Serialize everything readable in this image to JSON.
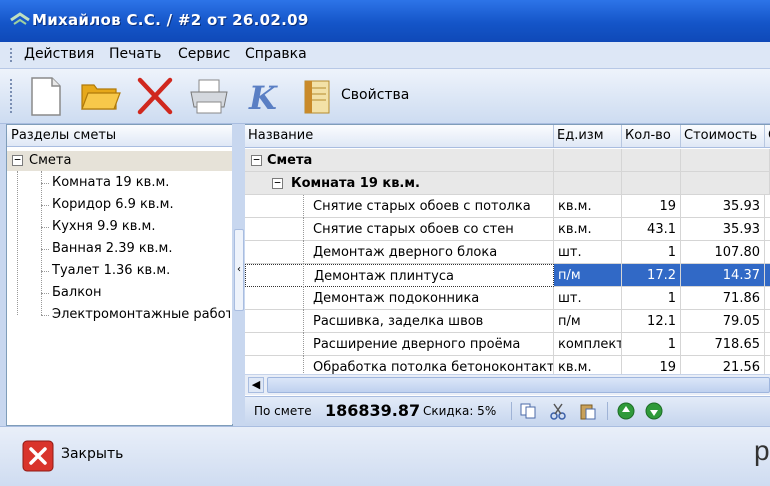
{
  "window": {
    "title": "Михайлов С.С. / #2 от 26.02.09"
  },
  "menu": [
    "Действия",
    "Печать",
    "Сервис",
    "Справка"
  ],
  "toolbar": {
    "buttons": [
      {
        "icon": "new-document-icon"
      },
      {
        "icon": "open-folder-icon"
      },
      {
        "icon": "delete-x-icon"
      },
      {
        "icon": "printer-icon"
      },
      {
        "icon": "k-letter-icon"
      }
    ],
    "properties_label": "Свойства"
  },
  "sections": {
    "header": "Разделы сметы",
    "root": "Смета",
    "items": [
      "Комната 19 кв.м.",
      "Коридор 6.9 кв.м.",
      "Кухня 9.9 кв.м.",
      "Ванная 2.39 кв.м.",
      "Туалет 1.36 кв.м.",
      "Балкон",
      "Электромонтажные работ"
    ]
  },
  "grid": {
    "columns": [
      "Название",
      "Ед.изм",
      "Кол-во",
      "Стоимость",
      "С"
    ],
    "root": "Смета",
    "group": "Комната 19 кв.м.",
    "rows": [
      {
        "name": "Снятие старых обоев с потолка",
        "unit": "кв.м.",
        "qty": "19",
        "cost": "35.93"
      },
      {
        "name": "Снятие старых обоев со стен",
        "unit": "кв.м.",
        "qty": "43.1",
        "cost": "35.93"
      },
      {
        "name": "Демонтаж дверного блока",
        "unit": "шт.",
        "qty": "1",
        "cost": "107.80"
      },
      {
        "name": "Демонтаж плинтуса",
        "unit": "п/м",
        "qty": "17.2",
        "cost": "14.37"
      },
      {
        "name": "Демонтаж подоконника",
        "unit": "шт.",
        "qty": "1",
        "cost": "71.86"
      },
      {
        "name": "Расшивка, заделка швов",
        "unit": "п/м",
        "qty": "12.1",
        "cost": "79.05"
      },
      {
        "name": "Расширение дверного проёма",
        "unit": "комплект",
        "qty": "1",
        "cost": "718.65"
      },
      {
        "name": "Обработка потолка бетоноконтакт",
        "unit": "кв.м.",
        "qty": "19",
        "cost": "21.56"
      }
    ],
    "selected_row_index": 3
  },
  "status": {
    "total_label": "По смете",
    "total_value": "186839.87",
    "discount_label": "Скидка: 5%"
  },
  "footer": {
    "close_label": "Закрыть",
    "brand_char": "p"
  },
  "colors": {
    "title_bar": "#1455c8",
    "selection": "#3169c6",
    "close_icon": "#d9342b"
  }
}
